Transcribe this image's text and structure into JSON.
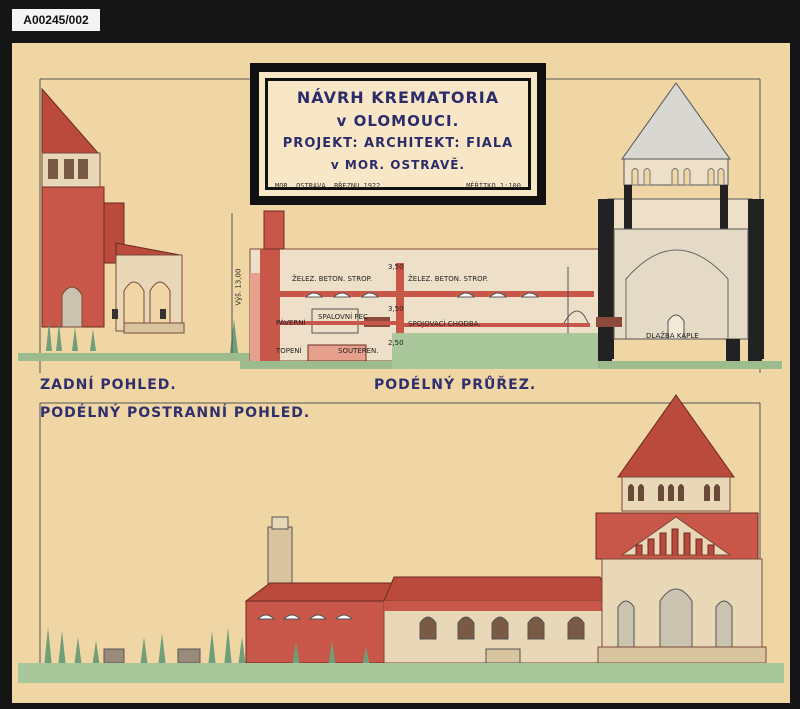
{
  "catalog_id": "A00245/002",
  "title": {
    "line1": "NÁVRH KREMATORIA",
    "line2": "v OLOMOUCI.",
    "line3": "PROJEKT: ARCHITEKT: FIALA",
    "line4": "v MOR. OSTRAVĚ.",
    "place_date": "MOR. OSTRAVA, BŘEZNU 1922",
    "scale": "MĚŘÍTKO 1:100"
  },
  "views": {
    "rear": "ZADNÍ POHLED.",
    "section": "PODÉLNÝ PRŮŘEZ.",
    "side": "PODÉLNÝ POSTRANNÍ POHLED."
  },
  "section_labels": {
    "ceiling_left": "ŽELEZ. BETON. STROP.",
    "ceiling_right": "ŽELEZ. BETON. STROP.",
    "furnace": "PÁVERNÍ",
    "cremation": "SPALOVNÍ PEC",
    "corridor": "SPOJOVACÍ CHODBA.",
    "heating": "TOPENÍ",
    "floor": "SOUTEREN.",
    "chapel_floor": "DLAŽBA KAPLE"
  },
  "dimensions": {
    "height": "Výš. 13,00",
    "d1": "3,50",
    "d2": "3,50",
    "d3": "2,50"
  },
  "colors": {
    "paper": "#f0d6a4",
    "ink": "#2f2f6e",
    "roof": "#b94a3c",
    "brick": "#c8574a",
    "stone": "#e9d8b8",
    "grass": "#8fb58a"
  }
}
